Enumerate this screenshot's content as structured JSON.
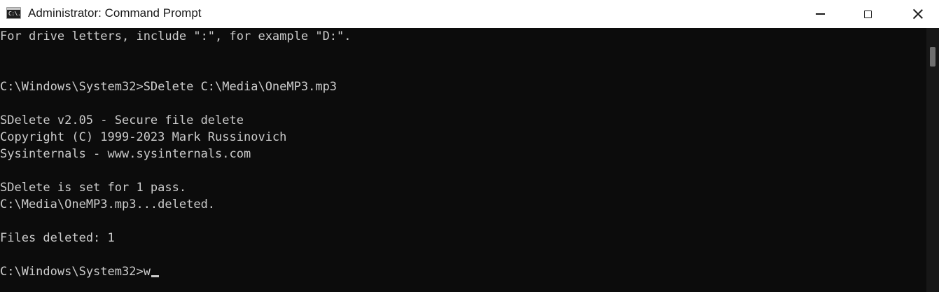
{
  "window": {
    "title": "Administrator: Command Prompt",
    "icon": "command-prompt-icon",
    "icon_text": "C:\\."
  },
  "controls": {
    "minimize": "minimize-icon",
    "maximize": "maximize-icon",
    "close": "close-icon"
  },
  "console": {
    "lines": [
      "For drive letters, include \":\", for example \"D:\".",
      "",
      "",
      "C:\\Windows\\System32>SDelete C:\\Media\\OneMP3.mp3",
      "",
      "SDelete v2.05 - Secure file delete",
      "Copyright (C) 1999-2023 Mark Russinovich",
      "Sysinternals - www.sysinternals.com",
      "",
      "SDelete is set for 1 pass.",
      "C:\\Media\\OneMP3.mp3...deleted.",
      "",
      "Files deleted: 1",
      "",
      "C:\\Windows\\System32>w"
    ]
  },
  "colors": {
    "console_background": "#0c0c0c",
    "console_text": "#cccccc",
    "titlebar_background": "#ffffff"
  }
}
